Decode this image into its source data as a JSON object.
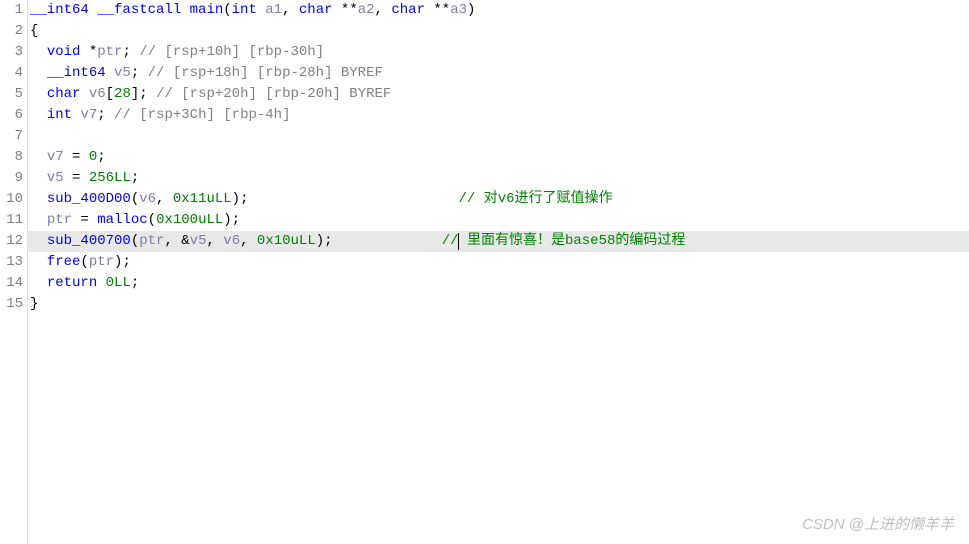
{
  "lines": [
    {
      "num": "1"
    },
    {
      "num": "2"
    },
    {
      "num": "3"
    },
    {
      "num": "4"
    },
    {
      "num": "5"
    },
    {
      "num": "6"
    },
    {
      "num": "7"
    },
    {
      "num": "8"
    },
    {
      "num": "9"
    },
    {
      "num": "10"
    },
    {
      "num": "11"
    },
    {
      "num": "12"
    },
    {
      "num": "13"
    },
    {
      "num": "14"
    },
    {
      "num": "15"
    }
  ],
  "code": {
    "l1": {
      "type1": "__int64",
      "type2": "__fastcall",
      "fn": "main",
      "sig": "(",
      "t_int": "int",
      "a1": "a1",
      "c1": ",",
      "t_char1": "char",
      "a2p": " **",
      "a2": "a2",
      "c2": ",",
      "t_char2": "char",
      "a3p": " **",
      "a3": "a3",
      "rp": ")"
    },
    "l2": {
      "brace": "{"
    },
    "l3": {
      "t": "void",
      "p": " *",
      "v": "ptr",
      "sc": ";",
      "c": " // [rsp+10h] [rbp-30h]"
    },
    "l4": {
      "t": "__int64",
      "v": "v5",
      "sc": ";",
      "c": " // [rsp+18h] [rbp-28h] BYREF"
    },
    "l5": {
      "t": "char",
      "v": "v6",
      "arr": "[",
      "n": "28",
      "arr2": "];",
      "c": " // [rsp+20h] [rbp-20h] BYREF"
    },
    "l6": {
      "t": "int",
      "v": "v7",
      "sc": ";",
      "c": " // [rsp+3Ch] [rbp-4h]"
    },
    "l8": {
      "v": "v7",
      "eq": " = ",
      "n": "0",
      "sc": ";"
    },
    "l9": {
      "v": "v5",
      "eq": " = ",
      "n": "256LL",
      "sc": ";"
    },
    "l10": {
      "fn": "sub_400D00",
      "lp": "(",
      "a1": "v6",
      "c1": ", ",
      "a2": "0x11uLL",
      "rp": ");",
      "cm": "// 对v6进行了赋值操作"
    },
    "l11": {
      "v": "ptr",
      "eq": " = ",
      "fn": "malloc",
      "lp": "(",
      "a": "0x100uLL",
      "rp": ");"
    },
    "l12": {
      "fn": "sub_400700",
      "lp": "(",
      "a1": "ptr",
      "c1": ", &",
      "a2": "v5",
      "c2": ", ",
      "a3": "v6",
      "c3": ", ",
      "a4": "0x10uLL",
      "rp": ");",
      "cm": "// 里面有惊喜！是base58的编码过程"
    },
    "l13": {
      "fn": "free",
      "lp": "(",
      "a": "ptr",
      "rp": ");"
    },
    "l14": {
      "kw": "return",
      "n": " 0LL",
      "sc": ";"
    },
    "l15": {
      "brace": "}"
    }
  },
  "watermark": "CSDN @上进的懒羊羊"
}
